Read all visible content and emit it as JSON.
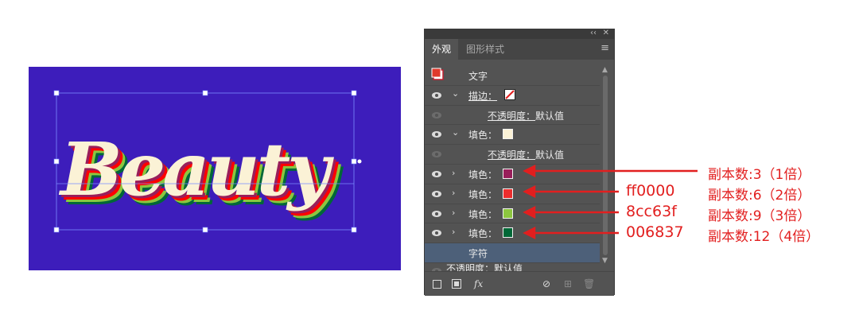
{
  "artwork": {
    "text": "Beauty",
    "background_color": "#3d1dbb",
    "fill_color": "#fbf2d6",
    "stroke_color": "#991e5a",
    "shadow_colors": [
      "#ff0000",
      "#8cc63f",
      "#006837"
    ]
  },
  "panel": {
    "topbar": {
      "collapse": "‹‹",
      "close": "✕"
    },
    "tabs": [
      {
        "label": "外观",
        "active": true
      },
      {
        "label": "图形样式",
        "active": false
      }
    ],
    "menu_icon": "hamburger-menu-icon",
    "rows": {
      "header": {
        "label": "文字"
      },
      "stroke": {
        "label": "描边：",
        "swatch": "none-slash"
      },
      "stroke_opacity": {
        "label": "不透明度：",
        "value": "默认值"
      },
      "fill_main": {
        "label": "填色：",
        "color": "#fbf2d6"
      },
      "fill_main_opacity": {
        "label": "不透明度：",
        "value": "默认值"
      },
      "fill_1": {
        "label": "填色：",
        "color": "#991e5a"
      },
      "fill_2": {
        "label": "填色：",
        "color": "#ec2d2d"
      },
      "fill_3": {
        "label": "填色：",
        "color": "#8cc63f"
      },
      "fill_4": {
        "label": "填色：",
        "color": "#006837"
      },
      "characters": {
        "label": "字符"
      },
      "char_opacity": {
        "label": "不透明度：",
        "value": "默认值"
      }
    },
    "bottom_icons": [
      "add-stroke-icon",
      "add-fill-icon",
      "fx-icon",
      "clear-icon",
      "duplicate-icon",
      "delete-icon"
    ],
    "fx_label": "fx"
  },
  "annotations": [
    {
      "hex": "",
      "copies": "副本数:3（1倍）"
    },
    {
      "hex": "ff0000",
      "copies": "副本数:6（2倍）"
    },
    {
      "hex": "8cc63f",
      "copies": "副本数:9（3倍）"
    },
    {
      "hex": "006837",
      "copies": "副本数:12（4倍）"
    }
  ],
  "annotation_color": "#e21f1f"
}
